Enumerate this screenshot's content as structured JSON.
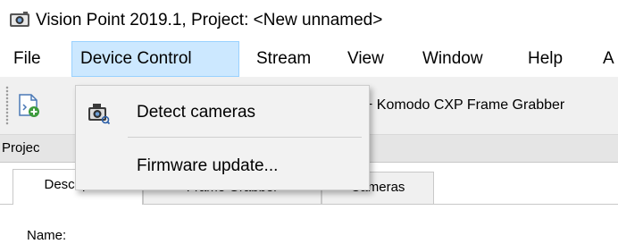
{
  "window": {
    "title": "Vision Point 2019.1, Project: <New unnamed>"
  },
  "menubar": {
    "items": [
      {
        "label": "File"
      },
      {
        "label": "Device Control"
      },
      {
        "label": "Stream"
      },
      {
        "label": "View"
      },
      {
        "label": "Window"
      },
      {
        "label": "Help"
      },
      {
        "label": "A"
      }
    ],
    "active_item": "Device Control"
  },
  "toolbar": {
    "grabber_label": "+ Komodo CXP Frame Grabber",
    "add_icon": "add-document-icon"
  },
  "dropdown": {
    "items": [
      {
        "label": "Detect cameras",
        "icon": "camera-detect-icon"
      },
      {
        "label": "Firmware update..."
      }
    ]
  },
  "panel": {
    "title": "Projec"
  },
  "tabs": [
    {
      "label": "Description",
      "active": true
    },
    {
      "label": "Frame Grabber"
    },
    {
      "label": "Cameras"
    }
  ],
  "form": {
    "name_label": "Name:"
  },
  "colors": {
    "menu_highlight": "#cce8ff",
    "menu_highlight_border": "#99d1ff",
    "dropdown_bg": "#f2f2f2",
    "toolbar_bg": "#f0f0f0"
  }
}
